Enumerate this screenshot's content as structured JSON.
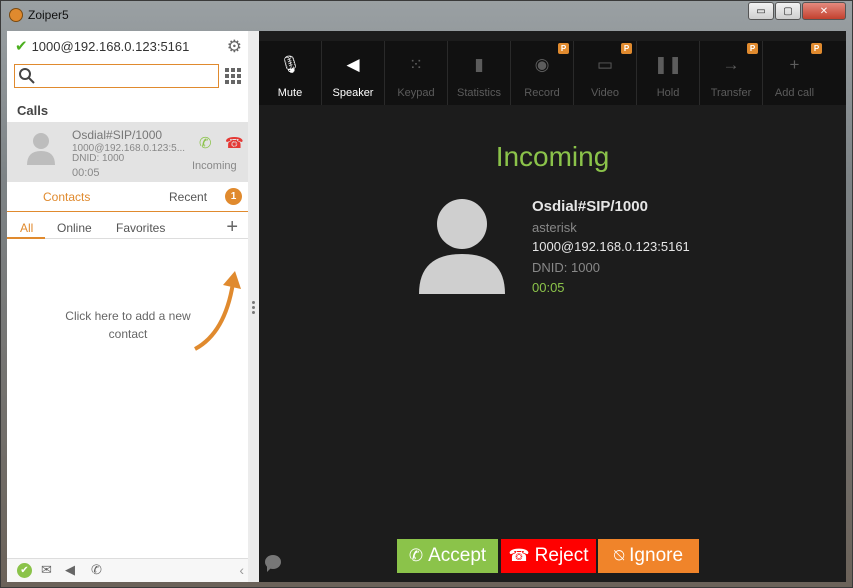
{
  "window": {
    "title": "Zoiper5",
    "minimize": "▭",
    "maximize": "▢",
    "close": "✕"
  },
  "account": {
    "status_icon": "check-icon",
    "label": "1000@192.168.0.123:5161"
  },
  "search": {
    "value": "",
    "placeholder": ""
  },
  "calls": {
    "header": "Calls",
    "items": [
      {
        "name": "Osdial#SIP/1000",
        "uri": "1000@192.168.0.123:5...",
        "dnid": "DNID: 1000",
        "time": "00:05",
        "status": "Incoming"
      }
    ]
  },
  "tabs": {
    "contacts": "Contacts",
    "recent": "Recent",
    "recent_badge": "1"
  },
  "filters": {
    "all": "All",
    "online": "Online",
    "favorites": "Favorites"
  },
  "contacts_hint": "Click here to add a new contact",
  "toolbar": [
    {
      "label": "Mute",
      "icon": "mic-off-icon",
      "glyph": "🎙",
      "state": "active",
      "premium": false
    },
    {
      "label": "Speaker",
      "icon": "speaker-icon",
      "glyph": "◀",
      "state": "active",
      "premium": false
    },
    {
      "label": "Keypad",
      "icon": "keypad-icon",
      "glyph": "⁙",
      "state": "disabled",
      "premium": false
    },
    {
      "label": "Statistics",
      "icon": "statistics-icon",
      "glyph": "▮",
      "state": "disabled",
      "premium": false
    },
    {
      "label": "Record",
      "icon": "record-icon",
      "glyph": "◉",
      "state": "disabled",
      "premium": true
    },
    {
      "label": "Video",
      "icon": "video-icon",
      "glyph": "▭",
      "state": "disabled",
      "premium": true
    },
    {
      "label": "Hold",
      "icon": "pause-icon",
      "glyph": "❚❚",
      "state": "disabled",
      "premium": false
    },
    {
      "label": "Transfer",
      "icon": "transfer-icon",
      "glyph": "→",
      "state": "disabled",
      "premium": true
    },
    {
      "label": "Add call",
      "icon": "add-call-icon",
      "glyph": "+",
      "state": "disabled",
      "premium": true
    }
  ],
  "premium_badge": "P",
  "incoming": {
    "title": "Incoming",
    "caller_name": "Osdial#SIP/1000",
    "caller_app": "asterisk",
    "caller_uri": "1000@192.168.0.123:5161",
    "caller_dnid": "DNID: 1000",
    "duration": "00:05"
  },
  "actions": {
    "accept": "Accept",
    "reject": "Reject",
    "ignore": "Ignore"
  },
  "colors": {
    "accent": "#e08a2e",
    "accept": "#8bc34a",
    "reject": "#ff0000",
    "ignore": "#f0842a",
    "panel_bg": "#1c1c1c"
  }
}
